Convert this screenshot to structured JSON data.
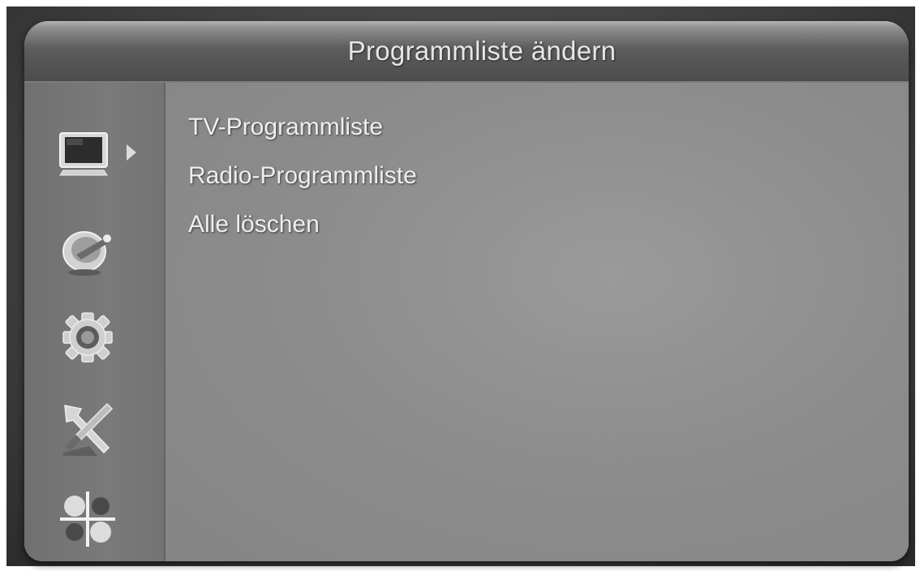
{
  "window": {
    "title": "Programmliste ändern"
  },
  "sidebar": {
    "items": [
      {
        "icon": "tv-icon",
        "selected": true
      },
      {
        "icon": "satellite-dish-icon",
        "selected": false
      },
      {
        "icon": "gear-icon",
        "selected": false
      },
      {
        "icon": "tools-icon",
        "selected": false
      },
      {
        "icon": "apps-grid-icon",
        "selected": false
      }
    ]
  },
  "menu": {
    "items": [
      {
        "label": "TV-Programmliste"
      },
      {
        "label": "Radio-Programmliste"
      },
      {
        "label": "Alle löschen"
      }
    ]
  }
}
